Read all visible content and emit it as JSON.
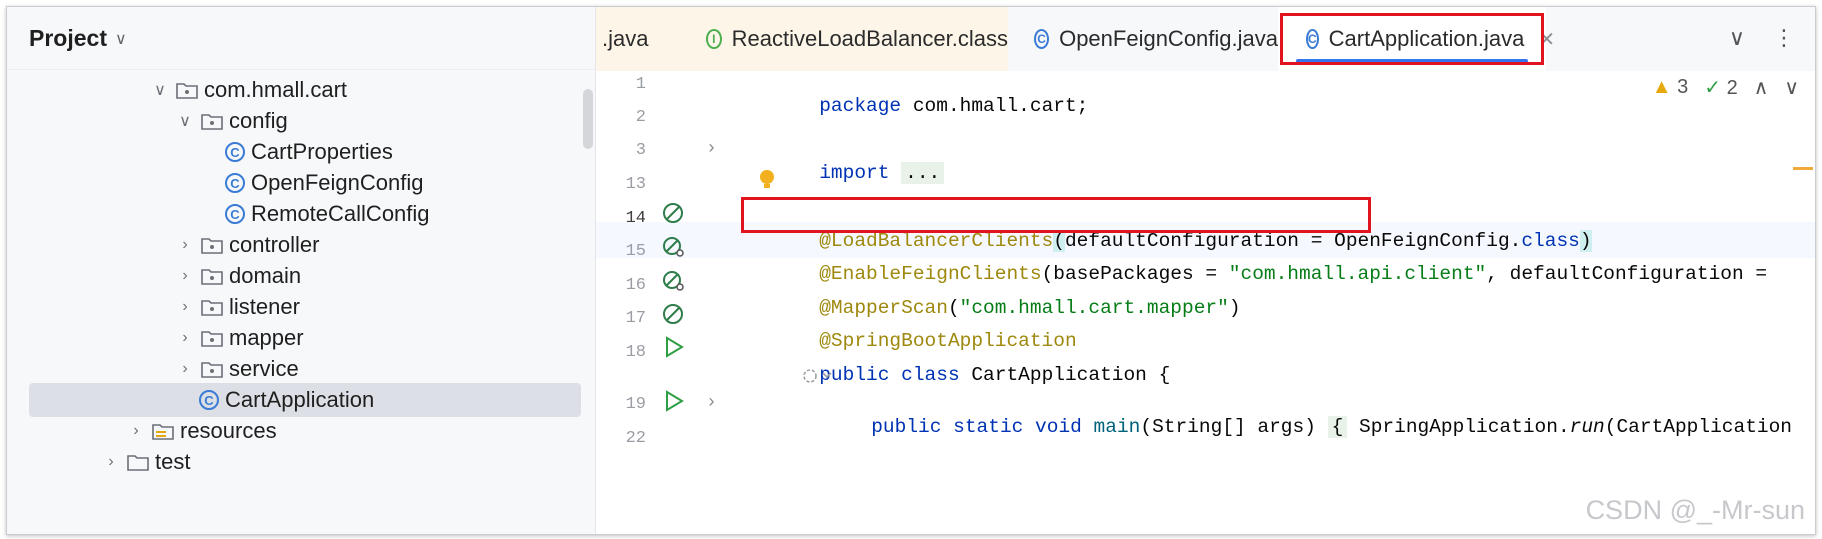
{
  "project": {
    "title": "Project",
    "tree": [
      {
        "label": "com.hmall.cart",
        "type": "package",
        "expanded": true
      },
      {
        "label": "config",
        "type": "package",
        "expanded": true
      },
      {
        "label": "CartProperties",
        "type": "class"
      },
      {
        "label": "OpenFeignConfig",
        "type": "class"
      },
      {
        "label": "RemoteCallConfig",
        "type": "class"
      },
      {
        "label": "controller",
        "type": "package"
      },
      {
        "label": "domain",
        "type": "package"
      },
      {
        "label": "listener",
        "type": "package"
      },
      {
        "label": "mapper",
        "type": "package"
      },
      {
        "label": "service",
        "type": "package"
      },
      {
        "label": "CartApplication",
        "type": "spring-class",
        "selected": true
      },
      {
        "label": "resources",
        "type": "folder"
      },
      {
        "label": "test",
        "type": "folder"
      }
    ]
  },
  "tabs": [
    {
      "label": ".java"
    },
    {
      "label": "ReactiveLoadBalancer.class"
    },
    {
      "label": "OpenFeignConfig.java"
    },
    {
      "label": "CartApplication.java",
      "active": true
    }
  ],
  "status": {
    "warnings": "3",
    "checks": "2"
  },
  "editor": {
    "line_numbers": [
      "1",
      "2",
      "3",
      "13",
      "14",
      "15",
      "16",
      "17",
      "18",
      "19",
      "22"
    ],
    "lines": {
      "l1_kw": "package",
      "l1_rest": " com.hmall.cart;",
      "l3_kw": "import",
      "l3_fold": "...",
      "l14_ann": "@LoadBalancerClients",
      "l14_open": "(",
      "l14_mid": "defaultConfiguration = OpenFeignConfig.",
      "l14_kw": "class",
      "l14_close": ")",
      "l15_ann": "@EnableFeignClients",
      "l15_a": "(basePackages = ",
      "l15_str": "\"com.hmall.api.client\"",
      "l15_b": ", defaultConfiguration =",
      "l16_ann": "@MapperScan",
      "l16_a": "(",
      "l16_str": "\"com.hmall.cart.mapper\"",
      "l16_b": ")",
      "l17_ann": "@SpringBootApplication",
      "l18_kw": "public class",
      "l18_rest": " CartApplication {",
      "l19_kw": "public static void",
      "l19_fn": " main",
      "l19_a": "(String[] args) ",
      "l19_body": "{",
      "l19_b": " SpringApplication.",
      "l19_run": "run",
      "l19_c": "(CartApplication"
    }
  },
  "watermark": "CSDN @_-Mr-sun"
}
